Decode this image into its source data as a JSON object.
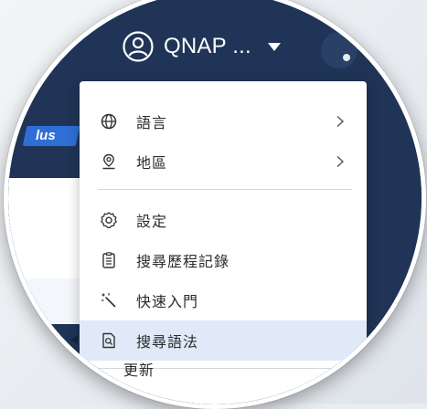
{
  "account": {
    "name": "QNAP ...",
    "avatar_icon": "user-circle-icon",
    "caret_icon": "caret-down-icon"
  },
  "badge": {
    "text": "lus"
  },
  "menu": {
    "items": [
      {
        "label": "語言",
        "icon": "globe-icon",
        "has_submenu": true
      },
      {
        "label": "地區",
        "icon": "location-pin-icon",
        "has_submenu": true
      },
      {
        "label": "設定",
        "icon": "settings-icon",
        "has_submenu": false
      },
      {
        "label": "搜尋歷程記錄",
        "icon": "clipboard-icon",
        "has_submenu": false
      },
      {
        "label": "快速入門",
        "icon": "magic-wand-icon",
        "has_submenu": false
      },
      {
        "label": "搜尋語法",
        "icon": "search-document-icon",
        "has_submenu": false,
        "selected": true
      }
    ],
    "partial_item_label": "更新"
  },
  "colors": {
    "topbar": "#1f3456",
    "selected_row": "#dfe9f7",
    "badge": "#2f6ed6"
  }
}
